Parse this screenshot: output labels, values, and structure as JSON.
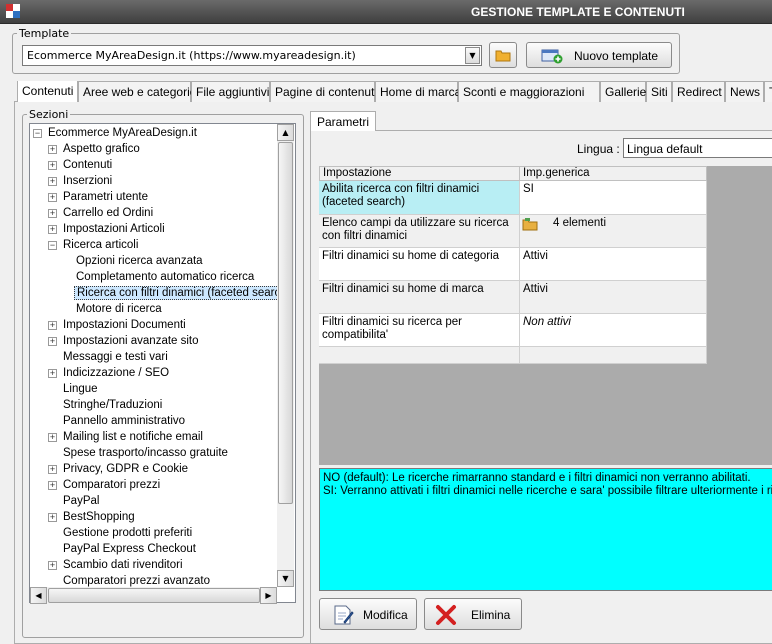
{
  "window": {
    "title": "GESTIONE TEMPLATE E CONTENUTI"
  },
  "template": {
    "group_label": "Template",
    "selected": "Ecommerce MyAreaDesign.it (https://www.myareadesign.it)",
    "new_button": "Nuovo template"
  },
  "tabs": [
    {
      "label": "Contenuti"
    },
    {
      "label": "Aree web e categorie"
    },
    {
      "label": "File aggiuntivi"
    },
    {
      "label": "Pagine di contenuti"
    },
    {
      "label": "Home di marca"
    },
    {
      "label": "Sconti e maggiorazioni"
    },
    {
      "label": "Gallerie"
    },
    {
      "label": "Siti"
    },
    {
      "label": "Redirect"
    },
    {
      "label": "News"
    },
    {
      "label": "Te"
    }
  ],
  "sections": {
    "group_label": "Sezioni",
    "tree": [
      {
        "label": "Ecommerce MyAreaDesign.it",
        "expander": "−"
      },
      {
        "label": "Aspetto grafico",
        "expander": "+"
      },
      {
        "label": "Contenuti",
        "expander": "+"
      },
      {
        "label": "Inserzioni",
        "expander": "+"
      },
      {
        "label": "Parametri utente",
        "expander": "+"
      },
      {
        "label": "Carrello ed Ordini",
        "expander": "+"
      },
      {
        "label": "Impostazioni Articoli",
        "expander": "+"
      },
      {
        "label": "Ricerca articoli",
        "expander": "−"
      },
      {
        "label": "Opzioni ricerca avanzata",
        "expander": ""
      },
      {
        "label": "Completamento automatico ricerca",
        "expander": ""
      },
      {
        "label": "Ricerca con filtri dinamici (faceted search)",
        "expander": "",
        "selected": true
      },
      {
        "label": "Motore di ricerca",
        "expander": ""
      },
      {
        "label": "Impostazioni Documenti",
        "expander": "+"
      },
      {
        "label": "Impostazioni avanzate sito",
        "expander": "+"
      },
      {
        "label": "Messaggi e testi vari",
        "expander": ""
      },
      {
        "label": "Indicizzazione / SEO",
        "expander": "+"
      },
      {
        "label": "Lingue",
        "expander": ""
      },
      {
        "label": "Stringhe/Traduzioni",
        "expander": ""
      },
      {
        "label": "Pannello amministrativo",
        "expander": ""
      },
      {
        "label": "Mailing list e notifiche email",
        "expander": "+"
      },
      {
        "label": "Spese trasporto/incasso gratuite",
        "expander": ""
      },
      {
        "label": "Privacy, GDPR e Cookie",
        "expander": "+"
      },
      {
        "label": "Comparatori prezzi",
        "expander": "+"
      },
      {
        "label": "PayPal",
        "expander": ""
      },
      {
        "label": "BestShopping",
        "expander": "+"
      },
      {
        "label": "Gestione prodotti preferiti",
        "expander": ""
      },
      {
        "label": "PayPal Express Checkout",
        "expander": ""
      },
      {
        "label": "Scambio dati rivenditori",
        "expander": "+"
      },
      {
        "label": "Comparatori prezzi avanzato",
        "expander": ""
      }
    ]
  },
  "params": {
    "tab_label": "Parametri",
    "lingua_label": "Lingua :",
    "lingua_value": "Lingua default",
    "columns": [
      "Impostazione",
      "Imp.generica"
    ],
    "rows": [
      {
        "setting": "Abilita ricerca con filtri dinamici (faceted search)",
        "value": "SI"
      },
      {
        "setting": "Elenco campi da utilizzare su ricerca con filtri dinamici",
        "value": "4 elementi"
      },
      {
        "setting": "Filtri dinamici su home di categoria",
        "value": "Attivi"
      },
      {
        "setting": "Filtri dinamici su home di marca",
        "value": "Attivi"
      },
      {
        "setting": "Filtri dinamici su ricerca per compatibilita'",
        "value": "Non attivi"
      }
    ],
    "description": [
      "NO (default): Le ricerche rimarranno standard e i filtri dinamici non verranno abilitati.",
      "SI: Verranno attivati i filtri dinamici nelle ricerche e sara' possibile filtrare ulteriormente i risultati"
    ],
    "edit_button": "Modifica",
    "delete_button": "Elimina"
  },
  "colors": {
    "selected_row": "#b8eef4",
    "description_bg": "#00ffff",
    "grid_background": "#ababab"
  }
}
